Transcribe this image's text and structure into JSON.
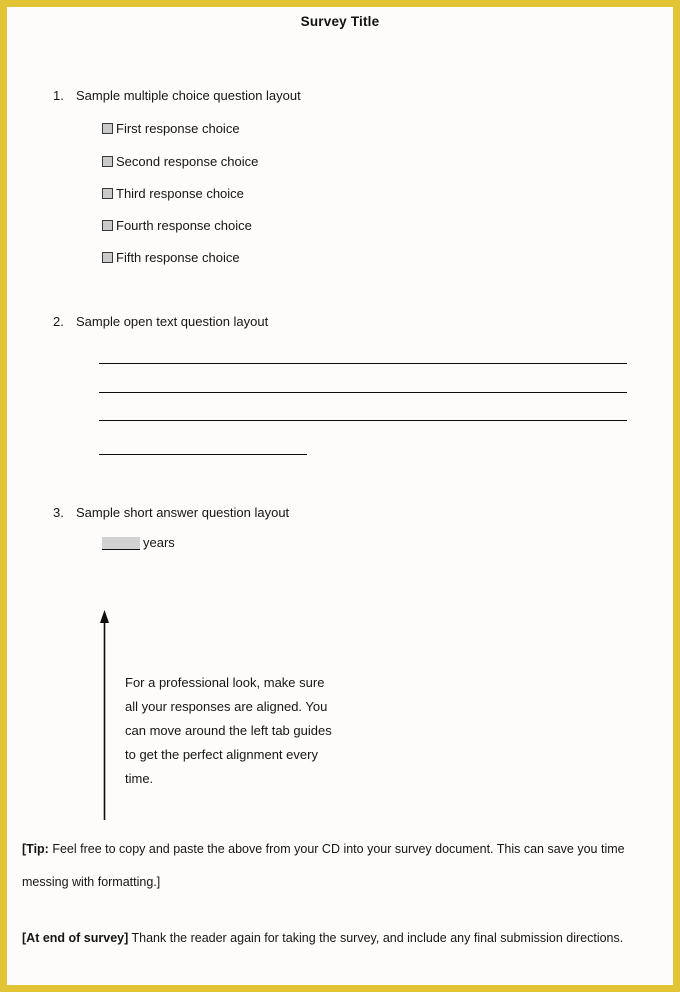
{
  "document": {
    "title": "Survey Title",
    "accent_color": "#e2c537",
    "page_background": "#fdfcfa"
  },
  "questions": [
    {
      "number": "1.",
      "text": "Sample multiple choice question layout",
      "type": "multiple-choice",
      "choices": [
        "First response choice",
        "Second response choice",
        "Third response choice",
        "Fourth response choice",
        "Fifth response choice"
      ]
    },
    {
      "number": "2.",
      "text": "Sample open text question layout",
      "type": "open-text",
      "line_count": 4
    },
    {
      "number": "3.",
      "text": "Sample short answer question layout",
      "type": "short-answer",
      "blank_value": "",
      "unit_label": "years"
    }
  ],
  "callout": {
    "text": "For a professional look, make sure all your responses are aligned. You can move around the left tab guides to get the perfect alignment every time.",
    "arrow_direction": "up"
  },
  "notes": [
    {
      "bold_prefix": "[Tip:",
      "body": " Feel free to copy and paste the above from your CD into your survey document. This can save you time messing with formatting.]"
    },
    {
      "bold_prefix": "[At end of survey]",
      "body": " Thank the reader again for taking the survey, and include any final submission directions."
    }
  ]
}
